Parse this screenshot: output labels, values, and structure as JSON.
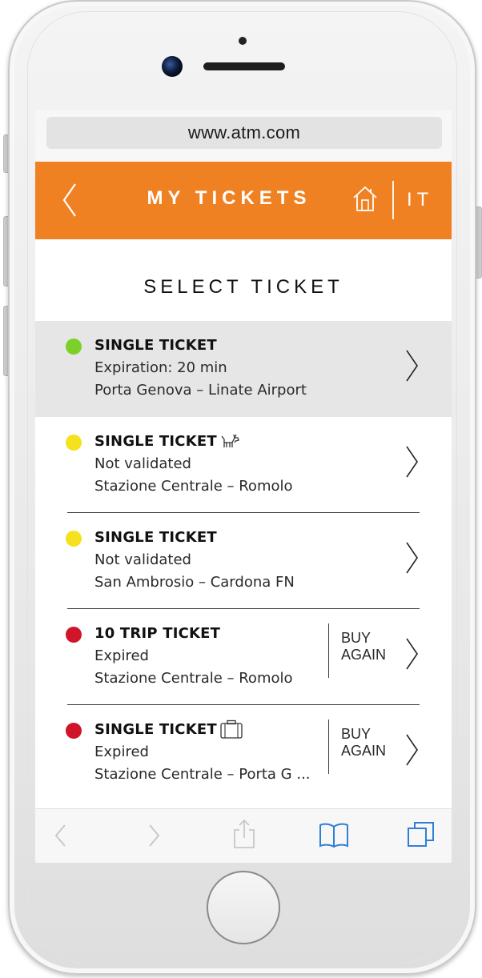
{
  "browser": {
    "url": "www.atm.com"
  },
  "header": {
    "title": "MY TICKETS",
    "language": "IT"
  },
  "section_title": "SELECT TICKET",
  "tickets": [
    {
      "name": "SINGLE TICKET",
      "status": "Expiration: 20 min",
      "route": "Porta Genova – Linate Airport",
      "state_color": "#7cd02a",
      "selected": true
    },
    {
      "name": "SINGLE TICKET",
      "status": "Not validated",
      "route": "Stazione Centrale – Romolo",
      "state_color": "#f5e21e",
      "extra_icon": "dog-icon"
    },
    {
      "name": "SINGLE TICKET",
      "status": "Not validated",
      "route": "San Ambrosio – Cardona FN",
      "state_color": "#f5e21e"
    },
    {
      "name": "10 TRIP TICKET",
      "status": "Expired",
      "route": "Stazione Centrale – Romolo",
      "state_color": "#d0152a",
      "action": "BUY AGAIN"
    },
    {
      "name": "SINGLE TICKET",
      "status": "Expired",
      "route": "Stazione Centrale – Porta G ...",
      "state_color": "#d0152a",
      "extra_icon": "luggage-icon",
      "action": "BUY AGAIN"
    }
  ],
  "buy_again_lines": [
    "BUY",
    "AGAIN"
  ],
  "colors": {
    "brand_orange": "#f08123",
    "ios_blue": "#2f7fd6"
  },
  "toolbar_icons": [
    "back-arrow-icon",
    "forward-arrow-icon",
    "share-icon",
    "bookmarks-icon",
    "tabs-icon"
  ]
}
